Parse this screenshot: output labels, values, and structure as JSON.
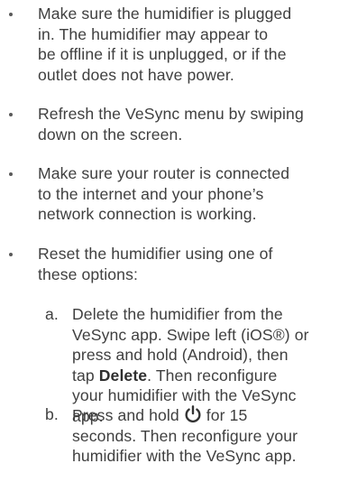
{
  "bullets": [
    {
      "text": "Make sure the humidifier is plugged\nin. The humidifier may appear to\nbe offline if it is unplugged, or if the\noutlet does not have power."
    },
    {
      "text": "Refresh the VeSync menu by swiping\ndown on the screen."
    },
    {
      "text": "Make sure your router is connected\nto the internet and your phone’s\nnetwork connection is working."
    },
    {
      "text": "Reset the humidifier using one of\nthese options:"
    }
  ],
  "sub_items": [
    {
      "letter": "a.",
      "text_before": "Delete the humidifier from the\nVeSync app. Swipe left (iOS®) or\npress and hold (Android), then\ntap ",
      "bold": "Delete",
      "text_after": ". Then reconfigure\nyour humidifier with the VeSync\napp."
    },
    {
      "letter": "b.",
      "text_before": "Press and hold",
      "icon": "power-icon",
      "text_after": "for 15\nseconds. Then reconfigure your\nhumidifier with the VeSync app."
    }
  ]
}
